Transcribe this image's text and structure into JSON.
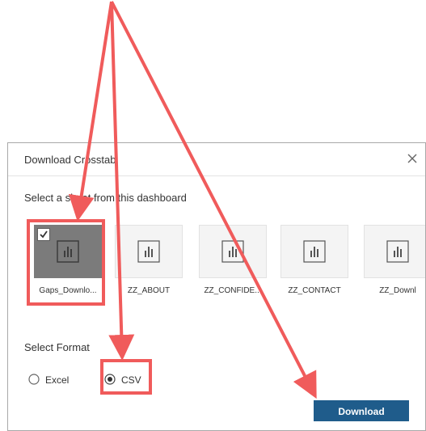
{
  "dialog": {
    "title": "Download Crosstab",
    "close_glyph": "✕",
    "sheet_prompt": "Select a sheet from this dashboard",
    "format_prompt": "Select Format",
    "download_label": "Download"
  },
  "sheets": [
    {
      "name": "Gaps_Downlo...",
      "selected": true,
      "icon": "bar-chart-icon"
    },
    {
      "name": "ZZ_ABOUT",
      "selected": false,
      "icon": "bar-chart-icon"
    },
    {
      "name": "ZZ_CONFIDE...",
      "selected": false,
      "icon": "bar-chart-icon"
    },
    {
      "name": "ZZ_CONTACT",
      "selected": false,
      "icon": "bar-chart-icon"
    },
    {
      "name": "ZZ_Downl",
      "selected": false,
      "icon": "bar-chart-icon"
    }
  ],
  "formats": [
    {
      "label": "Excel",
      "selected": false
    },
    {
      "label": "CSV",
      "selected": true
    }
  ],
  "colors": {
    "highlight": "#f05b5b",
    "button": "#1f5c8b",
    "selected_card": "#7b7b7b"
  }
}
